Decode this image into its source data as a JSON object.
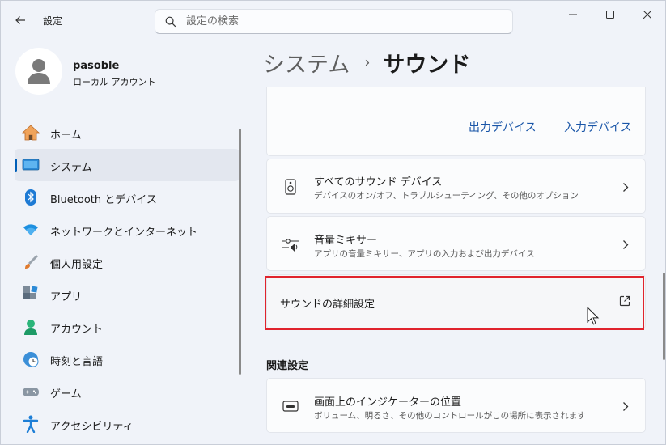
{
  "window": {
    "title": "設定",
    "search_placeholder": "設定の検索"
  },
  "profile": {
    "name": "pasoble",
    "account_type": "ローカル アカウント"
  },
  "sidebar": {
    "items": [
      {
        "label": "ホーム",
        "icon": "home-icon"
      },
      {
        "label": "システム",
        "icon": "system-icon",
        "active": true
      },
      {
        "label": "Bluetooth とデバイス",
        "icon": "bluetooth-icon"
      },
      {
        "label": "ネットワークとインターネット",
        "icon": "wifi-icon"
      },
      {
        "label": "個人用設定",
        "icon": "brush-icon"
      },
      {
        "label": "アプリ",
        "icon": "apps-icon"
      },
      {
        "label": "アカウント",
        "icon": "account-icon"
      },
      {
        "label": "時刻と言語",
        "icon": "clock-globe-icon"
      },
      {
        "label": "ゲーム",
        "icon": "gamepad-icon"
      },
      {
        "label": "アクセシビリティ",
        "icon": "accessibility-icon"
      }
    ]
  },
  "header": {
    "parent": "システム",
    "separator": "›",
    "current": "サウンド"
  },
  "tabs": {
    "output": "出力デバイス",
    "input": "入力デバイス"
  },
  "rows": {
    "all_devices": {
      "title": "すべてのサウンド デバイス",
      "subtitle": "デバイスのオン/オフ、トラブルシューティング、その他のオプション"
    },
    "mixer": {
      "title": "音量ミキサー",
      "subtitle": "アプリの音量ミキサー、アプリの入力および出力デバイス"
    },
    "advanced": {
      "title": "サウンドの詳細設定"
    }
  },
  "related": {
    "section_title": "関連設定",
    "indicator": {
      "title": "画面上のインジケーターの位置",
      "subtitle": "ボリューム、明るさ、その他のコントロールがこの場所に表示されます"
    }
  },
  "colors": {
    "accent": "#005fb8",
    "highlight_border": "#e0232d",
    "link": "#1a56a8"
  }
}
